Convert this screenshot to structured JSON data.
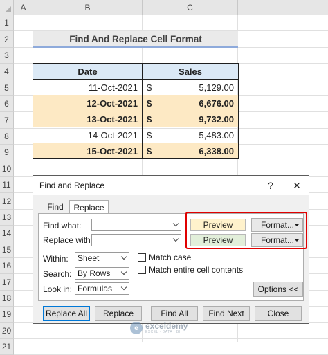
{
  "sheet": {
    "columns": [
      "A",
      "B",
      "C"
    ],
    "rows": [
      "1",
      "2",
      "3",
      "4",
      "5",
      "6",
      "7",
      "8",
      "9",
      "10",
      "11",
      "12",
      "13",
      "14",
      "15",
      "16",
      "17",
      "18",
      "19",
      "20",
      "21"
    ],
    "title": "Find And Replace Cell Format",
    "table": {
      "headers": [
        "Date",
        "Sales"
      ],
      "rows": [
        {
          "date": "11-Oct-2021",
          "currency": "$",
          "sales": "5,129.00",
          "highlighted": false
        },
        {
          "date": "12-Oct-2021",
          "currency": "$",
          "sales": "6,676.00",
          "highlighted": true
        },
        {
          "date": "13-Oct-2021",
          "currency": "$",
          "sales": "9,732.00",
          "highlighted": true
        },
        {
          "date": "14-Oct-2021",
          "currency": "$",
          "sales": "5,483.00",
          "highlighted": false
        },
        {
          "date": "15-Oct-2021",
          "currency": "$",
          "sales": "6,338.00",
          "highlighted": true
        }
      ]
    }
  },
  "dialog": {
    "title": "Find and Replace",
    "help_label": "?",
    "close_label": "✕",
    "tabs": {
      "find": "Find",
      "replace": "Replace"
    },
    "find_label": "Find what:",
    "replace_label": "Replace with:",
    "find_value": "",
    "replace_value": "",
    "preview_find": "Preview",
    "preview_replace": "Preview",
    "format_find": "Format...",
    "format_replace": "Format...",
    "within_label": "Within:",
    "within_value": "Sheet",
    "search_label": "Search:",
    "search_value": "By Rows",
    "lookin_label": "Look in:",
    "lookin_value": "Formulas",
    "match_case": "Match case",
    "match_entire": "Match entire cell contents",
    "options_button": "Options <<",
    "buttons": {
      "replace_all": "Replace All",
      "replace": "Replace",
      "find_all": "Find All",
      "find_next": "Find Next",
      "close": "Close"
    },
    "colors": {
      "preview_find_bg": "#fff2cc",
      "preview_replace_bg": "#e2efda",
      "highlight_box": "#e00000"
    }
  },
  "watermark": {
    "name": "exceldemy",
    "tagline": "EXCEL · DATA · BI"
  }
}
